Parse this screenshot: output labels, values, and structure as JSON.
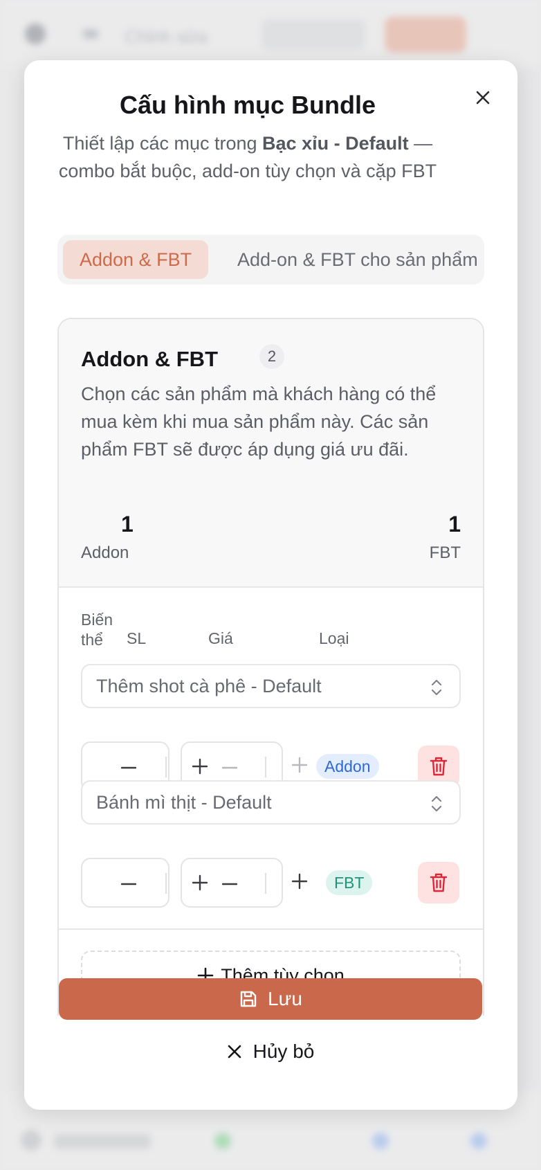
{
  "background": {
    "breadcrumb": "Chỉnh sửa"
  },
  "modal": {
    "title": "Cấu hình mục Bundle",
    "subtitle_prefix": "Thiết lập các mục trong ",
    "subtitle_bold": "Bạc xỉu - Default",
    "subtitle_suffix": " — combo bắt buộc, add-on tùy chọn và cặp FBT",
    "close_icon": "close-icon"
  },
  "tabs": [
    {
      "label": "Addon & FBT",
      "active": true
    },
    {
      "label": "Add-on & FBT cho sản phẩm",
      "active": false
    }
  ],
  "section": {
    "title": "Addon & FBT",
    "count": "2",
    "description": "Chọn các sản phẩm mà khách hàng có thể mua kèm khi mua sản phẩm này. Các sản phẩm FBT sẽ được áp dụng giá ưu đãi.",
    "stats": {
      "addon_value": "1",
      "addon_label": "Addon",
      "fbt_value": "1",
      "fbt_label": "FBT"
    },
    "columns": {
      "variant": "Biến thể",
      "qty": "SL",
      "price": "Giá",
      "type": "Loại"
    },
    "items": [
      {
        "variant": "Thêm shot cà phê - Default",
        "type": "Addon"
      },
      {
        "variant": "Bánh mì thịt - Default",
        "type": "FBT"
      }
    ],
    "add_option_label": "Thêm tùy chọn"
  },
  "footer": {
    "save_label": "Lưu",
    "cancel_label": "Hủy bỏ"
  },
  "colors": {
    "accent": "#c9684b",
    "addon_badge": "#2e69d3",
    "fbt_badge": "#20937a",
    "danger": "#d8283a"
  }
}
